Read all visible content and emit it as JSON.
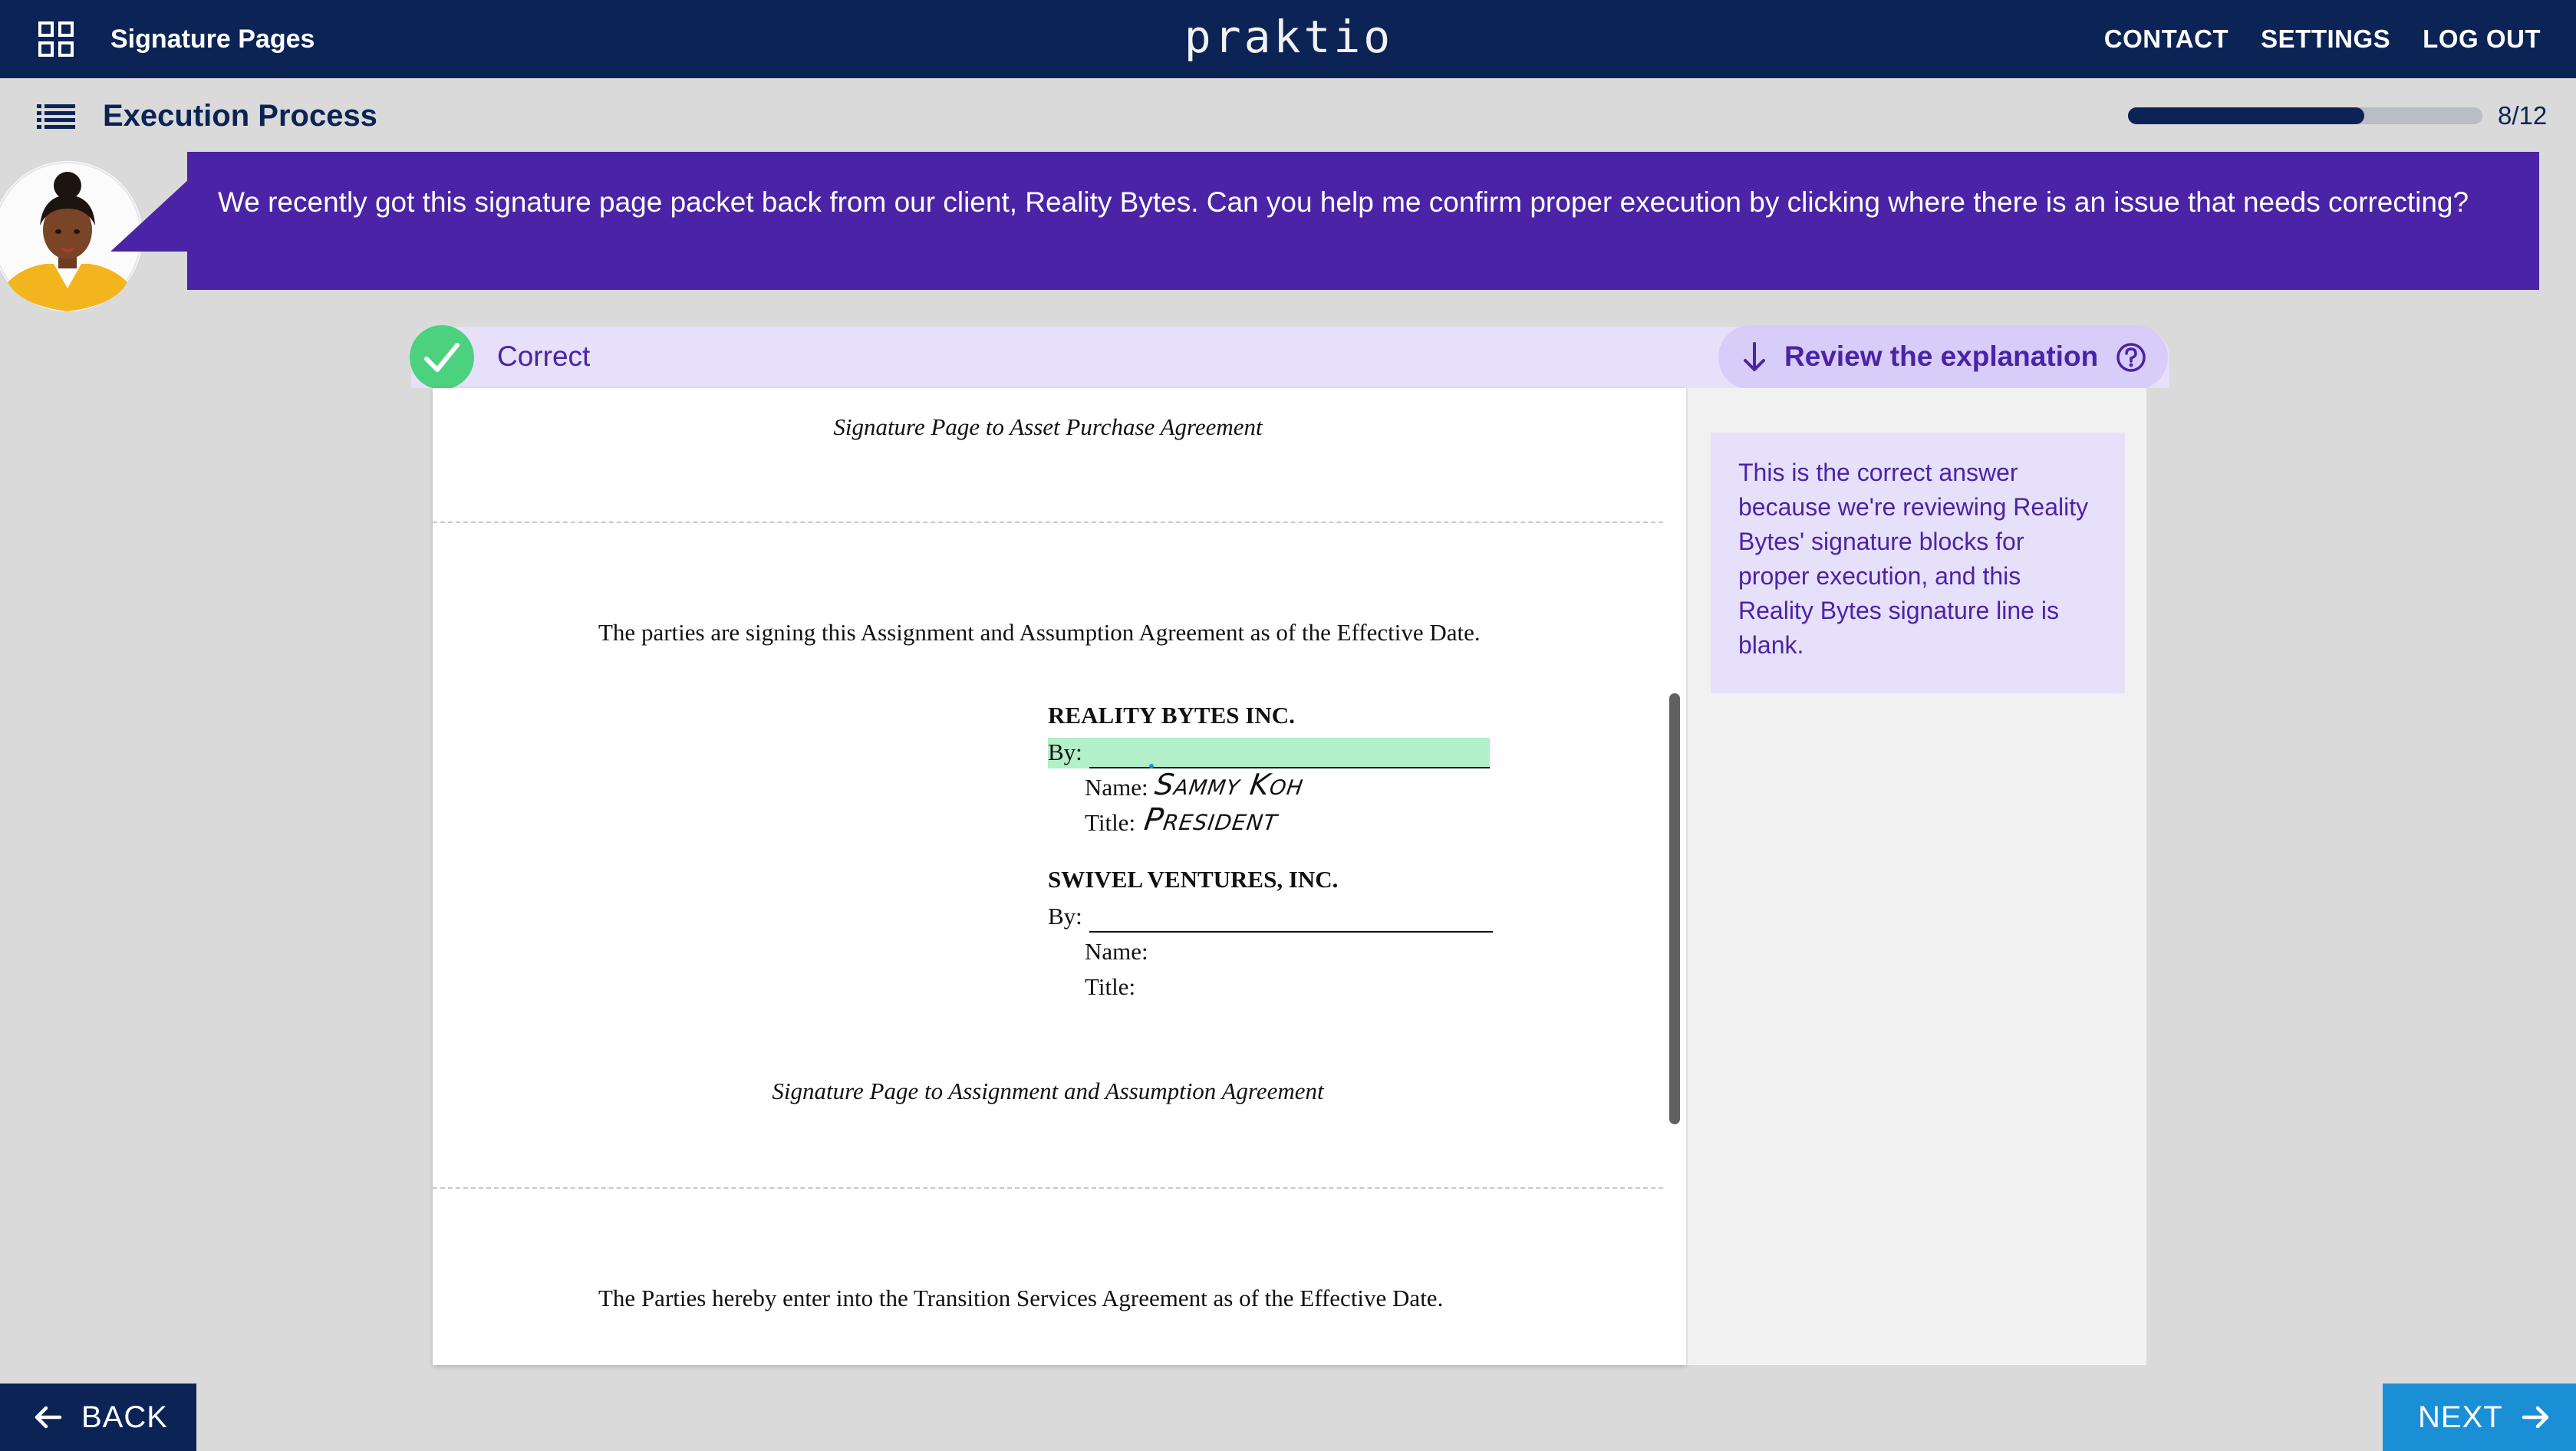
{
  "header": {
    "app_name": "Signature Pages",
    "logo": "praktio",
    "nav": {
      "contact": "CONTACT",
      "settings": "SETTINGS",
      "logout": "LOG OUT"
    }
  },
  "subheader": {
    "title": "Execution Process",
    "progress_text": "8/12",
    "progress_fraction": 0.667
  },
  "prompt": {
    "text": "We recently got this signature page packet back from our client, Reality Bytes. Can you help me confirm proper execution by clicking where there is an issue that needs correcting?"
  },
  "result": {
    "status": "Correct",
    "review_label": "Review the explanation"
  },
  "document": {
    "prev_caption": "Signature Page to Asset Purchase Agreement",
    "intro": "The parties are signing this Assignment and Assumption Agreement as of the Effective Date.",
    "party1": {
      "name": "REALITY BYTES INC.",
      "by": "By:",
      "name_label": "Name:",
      "name_value": "Sammy Koh",
      "title_label": "Title:",
      "title_value": "President"
    },
    "party2": {
      "name": "SWIVEL VENTURES, INC.",
      "by": "By:",
      "name_label": "Name:",
      "title_label": "Title:"
    },
    "caption": "Signature Page to Assignment and Assumption Agreement",
    "next_intro": "The Parties hereby enter into the Transition Services Agreement as of the Effective Date."
  },
  "explanation": {
    "text": "This is the correct answer because we're reviewing Reality Bytes' signature blocks for proper execution, and this Reality Bytes signature line is blank."
  },
  "footer": {
    "back": "BACK",
    "next": "NEXT"
  },
  "colors": {
    "navy": "#0b2455",
    "purple": "#4b23a6",
    "correct_green": "#4cd17f",
    "highlight": "#b2f0c9",
    "next_blue": "#1a8fd6"
  }
}
